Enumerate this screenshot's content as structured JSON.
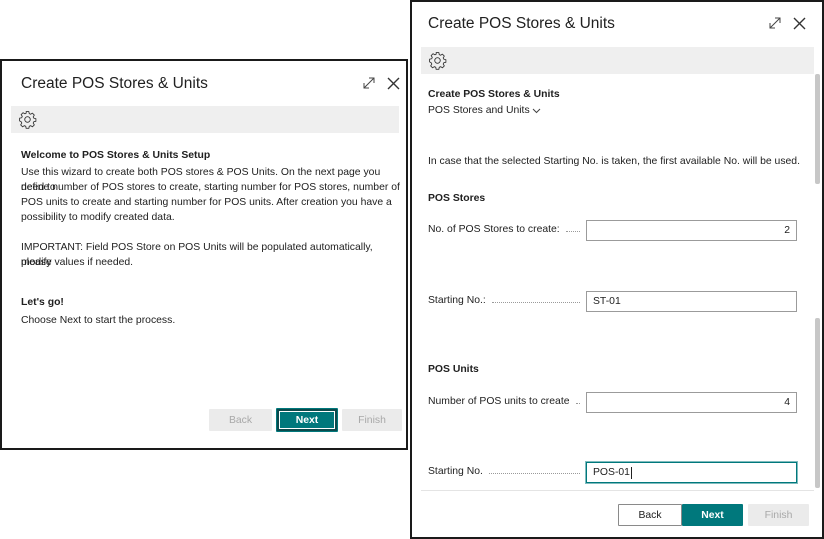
{
  "wizard1": {
    "title": "Create POS Stores & Units",
    "welcome_heading": "Welcome to POS Stores & Units Setup",
    "intro_lines": [
      "Use this wizard to create both POS stores & POS Units. On the next page you need to",
      "define number of POS stores to create, starting number for POS stores, number of",
      "POS units to create and starting number for POS units. After creation you have a",
      "possibility to modify created data."
    ],
    "important_lines": [
      "IMPORTANT: Field POS Store on POS Units will be populated automatically, please",
      "modify values if needed."
    ],
    "lets_go_heading": "Let's go!",
    "lets_go_text": "Choose Next to start the process.",
    "back_label": "Back",
    "next_label": "Next",
    "finish_label": "Finish"
  },
  "wizard2": {
    "title": "Create POS Stores & Units",
    "page_caption": "Create POS Stores & Units",
    "breadcrumb": "POS Stores and Units",
    "info_text": "In case that the selected Starting No. is taken, the first available No. will be used.",
    "stores_heading": "POS Stores",
    "stores_count_label": "No. of POS Stores to create:",
    "stores_count_value": "2",
    "stores_start_label": "Starting No.:",
    "stores_start_value": "ST-01",
    "units_heading": "POS Units",
    "units_count_label": "Number of POS units to create",
    "units_count_value": "4",
    "units_start_label": "Starting No.",
    "units_start_value": "POS-01",
    "back_label": "Back",
    "next_label": "Next",
    "finish_label": "Finish"
  },
  "icons": {
    "settings": "gear-icon",
    "expand": "expand-icon",
    "close": "close-icon",
    "dropdown": "chevron-down-icon"
  },
  "colors": {
    "primary": "#00787c",
    "disabled_bg": "#ebebeb",
    "disabled_text": "#a8a8a8",
    "gear_bar": "#efefef"
  }
}
